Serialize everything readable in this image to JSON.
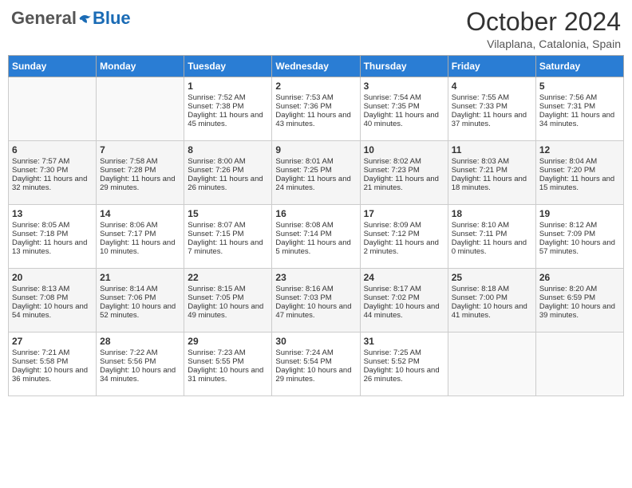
{
  "header": {
    "logo_general": "General",
    "logo_blue": "Blue",
    "title": "October 2024",
    "location": "Vilaplana, Catalonia, Spain"
  },
  "days_of_week": [
    "Sunday",
    "Monday",
    "Tuesday",
    "Wednesday",
    "Thursday",
    "Friday",
    "Saturday"
  ],
  "weeks": [
    [
      {
        "day": "",
        "sunrise": "",
        "sunset": "",
        "daylight": ""
      },
      {
        "day": "",
        "sunrise": "",
        "sunset": "",
        "daylight": ""
      },
      {
        "day": "1",
        "sunrise": "Sunrise: 7:52 AM",
        "sunset": "Sunset: 7:38 PM",
        "daylight": "Daylight: 11 hours and 45 minutes."
      },
      {
        "day": "2",
        "sunrise": "Sunrise: 7:53 AM",
        "sunset": "Sunset: 7:36 PM",
        "daylight": "Daylight: 11 hours and 43 minutes."
      },
      {
        "day": "3",
        "sunrise": "Sunrise: 7:54 AM",
        "sunset": "Sunset: 7:35 PM",
        "daylight": "Daylight: 11 hours and 40 minutes."
      },
      {
        "day": "4",
        "sunrise": "Sunrise: 7:55 AM",
        "sunset": "Sunset: 7:33 PM",
        "daylight": "Daylight: 11 hours and 37 minutes."
      },
      {
        "day": "5",
        "sunrise": "Sunrise: 7:56 AM",
        "sunset": "Sunset: 7:31 PM",
        "daylight": "Daylight: 11 hours and 34 minutes."
      }
    ],
    [
      {
        "day": "6",
        "sunrise": "Sunrise: 7:57 AM",
        "sunset": "Sunset: 7:30 PM",
        "daylight": "Daylight: 11 hours and 32 minutes."
      },
      {
        "day": "7",
        "sunrise": "Sunrise: 7:58 AM",
        "sunset": "Sunset: 7:28 PM",
        "daylight": "Daylight: 11 hours and 29 minutes."
      },
      {
        "day": "8",
        "sunrise": "Sunrise: 8:00 AM",
        "sunset": "Sunset: 7:26 PM",
        "daylight": "Daylight: 11 hours and 26 minutes."
      },
      {
        "day": "9",
        "sunrise": "Sunrise: 8:01 AM",
        "sunset": "Sunset: 7:25 PM",
        "daylight": "Daylight: 11 hours and 24 minutes."
      },
      {
        "day": "10",
        "sunrise": "Sunrise: 8:02 AM",
        "sunset": "Sunset: 7:23 PM",
        "daylight": "Daylight: 11 hours and 21 minutes."
      },
      {
        "day": "11",
        "sunrise": "Sunrise: 8:03 AM",
        "sunset": "Sunset: 7:21 PM",
        "daylight": "Daylight: 11 hours and 18 minutes."
      },
      {
        "day": "12",
        "sunrise": "Sunrise: 8:04 AM",
        "sunset": "Sunset: 7:20 PM",
        "daylight": "Daylight: 11 hours and 15 minutes."
      }
    ],
    [
      {
        "day": "13",
        "sunrise": "Sunrise: 8:05 AM",
        "sunset": "Sunset: 7:18 PM",
        "daylight": "Daylight: 11 hours and 13 minutes."
      },
      {
        "day": "14",
        "sunrise": "Sunrise: 8:06 AM",
        "sunset": "Sunset: 7:17 PM",
        "daylight": "Daylight: 11 hours and 10 minutes."
      },
      {
        "day": "15",
        "sunrise": "Sunrise: 8:07 AM",
        "sunset": "Sunset: 7:15 PM",
        "daylight": "Daylight: 11 hours and 7 minutes."
      },
      {
        "day": "16",
        "sunrise": "Sunrise: 8:08 AM",
        "sunset": "Sunset: 7:14 PM",
        "daylight": "Daylight: 11 hours and 5 minutes."
      },
      {
        "day": "17",
        "sunrise": "Sunrise: 8:09 AM",
        "sunset": "Sunset: 7:12 PM",
        "daylight": "Daylight: 11 hours and 2 minutes."
      },
      {
        "day": "18",
        "sunrise": "Sunrise: 8:10 AM",
        "sunset": "Sunset: 7:11 PM",
        "daylight": "Daylight: 11 hours and 0 minutes."
      },
      {
        "day": "19",
        "sunrise": "Sunrise: 8:12 AM",
        "sunset": "Sunset: 7:09 PM",
        "daylight": "Daylight: 10 hours and 57 minutes."
      }
    ],
    [
      {
        "day": "20",
        "sunrise": "Sunrise: 8:13 AM",
        "sunset": "Sunset: 7:08 PM",
        "daylight": "Daylight: 10 hours and 54 minutes."
      },
      {
        "day": "21",
        "sunrise": "Sunrise: 8:14 AM",
        "sunset": "Sunset: 7:06 PM",
        "daylight": "Daylight: 10 hours and 52 minutes."
      },
      {
        "day": "22",
        "sunrise": "Sunrise: 8:15 AM",
        "sunset": "Sunset: 7:05 PM",
        "daylight": "Daylight: 10 hours and 49 minutes."
      },
      {
        "day": "23",
        "sunrise": "Sunrise: 8:16 AM",
        "sunset": "Sunset: 7:03 PM",
        "daylight": "Daylight: 10 hours and 47 minutes."
      },
      {
        "day": "24",
        "sunrise": "Sunrise: 8:17 AM",
        "sunset": "Sunset: 7:02 PM",
        "daylight": "Daylight: 10 hours and 44 minutes."
      },
      {
        "day": "25",
        "sunrise": "Sunrise: 8:18 AM",
        "sunset": "Sunset: 7:00 PM",
        "daylight": "Daylight: 10 hours and 41 minutes."
      },
      {
        "day": "26",
        "sunrise": "Sunrise: 8:20 AM",
        "sunset": "Sunset: 6:59 PM",
        "daylight": "Daylight: 10 hours and 39 minutes."
      }
    ],
    [
      {
        "day": "27",
        "sunrise": "Sunrise: 7:21 AM",
        "sunset": "Sunset: 5:58 PM",
        "daylight": "Daylight: 10 hours and 36 minutes."
      },
      {
        "day": "28",
        "sunrise": "Sunrise: 7:22 AM",
        "sunset": "Sunset: 5:56 PM",
        "daylight": "Daylight: 10 hours and 34 minutes."
      },
      {
        "day": "29",
        "sunrise": "Sunrise: 7:23 AM",
        "sunset": "Sunset: 5:55 PM",
        "daylight": "Daylight: 10 hours and 31 minutes."
      },
      {
        "day": "30",
        "sunrise": "Sunrise: 7:24 AM",
        "sunset": "Sunset: 5:54 PM",
        "daylight": "Daylight: 10 hours and 29 minutes."
      },
      {
        "day": "31",
        "sunrise": "Sunrise: 7:25 AM",
        "sunset": "Sunset: 5:52 PM",
        "daylight": "Daylight: 10 hours and 26 minutes."
      },
      {
        "day": "",
        "sunrise": "",
        "sunset": "",
        "daylight": ""
      },
      {
        "day": "",
        "sunrise": "",
        "sunset": "",
        "daylight": ""
      }
    ]
  ]
}
